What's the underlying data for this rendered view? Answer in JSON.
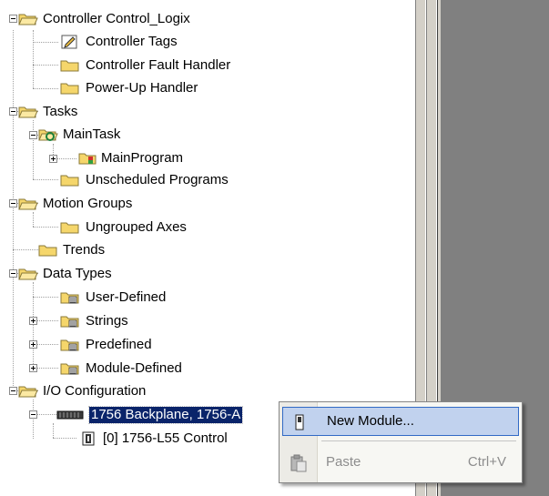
{
  "tree": {
    "controller": "Controller Control_Logix",
    "controller_tags": "Controller Tags",
    "fault_handler": "Controller Fault Handler",
    "powerup_handler": "Power-Up Handler",
    "tasks": "Tasks",
    "main_task": "MainTask",
    "main_program": "MainProgram",
    "unscheduled_programs": "Unscheduled Programs",
    "motion_groups": "Motion Groups",
    "ungrouped_axes": "Ungrouped Axes",
    "trends": "Trends",
    "data_types": "Data Types",
    "user_defined": "User-Defined",
    "strings": "Strings",
    "predefined": "Predefined",
    "module_defined": "Module-Defined",
    "io_configuration": "I/O Configuration",
    "backplane": "1756 Backplane, 1756-A",
    "controller_module": "[0] 1756-L55 Control"
  },
  "icons": {
    "folder": "folder-icon",
    "open_folder": "open-folder-icon",
    "tags": "tags-icon",
    "task": "task-icon",
    "program": "program-icon",
    "datatype": "data-type-icon",
    "backplane": "backplane-icon",
    "module": "module-icon"
  },
  "colors": {
    "selection": "#0a246a",
    "menu_hover": "#c1d2ee",
    "menu_hover_border": "#316ac5",
    "right_pane": "#808080",
    "folder": "#f5d66b"
  },
  "context_menu": {
    "new_module": "New Module...",
    "paste": "Paste",
    "paste_shortcut": "Ctrl+V"
  }
}
